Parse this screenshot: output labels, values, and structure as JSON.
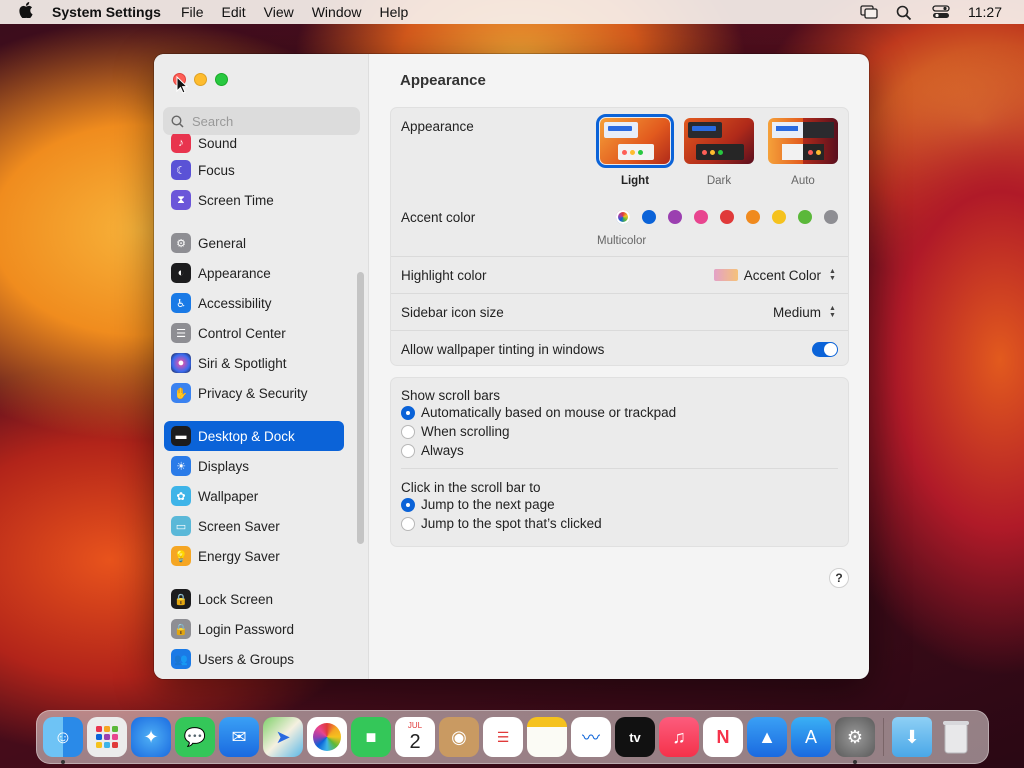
{
  "menubar": {
    "app_name": "System Settings",
    "menus": [
      "File",
      "Edit",
      "View",
      "Window",
      "Help"
    ],
    "clock": "11:27"
  },
  "search": {
    "placeholder": "Search"
  },
  "sidebar": {
    "items": [
      {
        "label": "Sound",
        "color": "#e8344e"
      },
      {
        "label": "Focus",
        "color": "#5a52d6"
      },
      {
        "label": "Screen Time",
        "color": "#6b56d9"
      },
      {
        "label": "General",
        "color": "#8e8e93"
      },
      {
        "label": "Appearance",
        "color": "#1c1c1e"
      },
      {
        "label": "Accessibility",
        "color": "#1a7ae6"
      },
      {
        "label": "Control Center",
        "color": "#8e8e93"
      },
      {
        "label": "Siri & Spotlight",
        "color": "#3a2a6a"
      },
      {
        "label": "Privacy & Security",
        "color": "#3a82f0"
      },
      {
        "label": "Desktop & Dock",
        "color": "#1c1c1e",
        "active": true
      },
      {
        "label": "Displays",
        "color": "#2a7be8"
      },
      {
        "label": "Wallpaper",
        "color": "#3eb4e8"
      },
      {
        "label": "Screen Saver",
        "color": "#5ab8d8"
      },
      {
        "label": "Energy Saver",
        "color": "#f5a623"
      },
      {
        "label": "Lock Screen",
        "color": "#1c1c1e"
      },
      {
        "label": "Login Password",
        "color": "#8e8e93"
      },
      {
        "label": "Users & Groups",
        "color": "#1a7ae6"
      }
    ]
  },
  "content": {
    "title": "Appearance",
    "appearance_label": "Appearance",
    "modes": [
      {
        "label": "Light",
        "selected": true
      },
      {
        "label": "Dark"
      },
      {
        "label": "Auto"
      }
    ],
    "accent_label": "Accent color",
    "accent_caption": "Multicolor",
    "accent_colors": [
      "multicolor",
      "#0b63d8",
      "#9b3fb0",
      "#e8458f",
      "#e03a3a",
      "#f08a1e",
      "#f5c21e",
      "#5bb83a",
      "#8e8e93"
    ],
    "highlight_label": "Highlight color",
    "highlight_value": "Accent Color",
    "sidebar_size_label": "Sidebar icon size",
    "sidebar_size_value": "Medium",
    "tinting_label": "Allow wallpaper tinting in windows",
    "tinting_on": true,
    "scrollbars_title": "Show scroll bars",
    "scrollbars_options": [
      {
        "label": "Automatically based on mouse or trackpad",
        "selected": true
      },
      {
        "label": "When scrolling"
      },
      {
        "label": "Always"
      }
    ],
    "click_title": "Click in the scroll bar to",
    "click_options": [
      {
        "label": "Jump to the next page",
        "selected": true
      },
      {
        "label": "Jump to the spot that’s clicked"
      }
    ],
    "help": "?"
  },
  "dock": {
    "calendar_month": "JUL",
    "calendar_day": "2",
    "tv_label": "tv",
    "apps": [
      "finder",
      "launchpad",
      "safari",
      "messages",
      "mail",
      "maps",
      "photos",
      "facetime",
      "calendar",
      "contacts",
      "reminders",
      "notes",
      "freeform",
      "tv",
      "music",
      "news",
      "keynote",
      "app-store",
      "system-settings",
      "downloads",
      "trash"
    ]
  }
}
